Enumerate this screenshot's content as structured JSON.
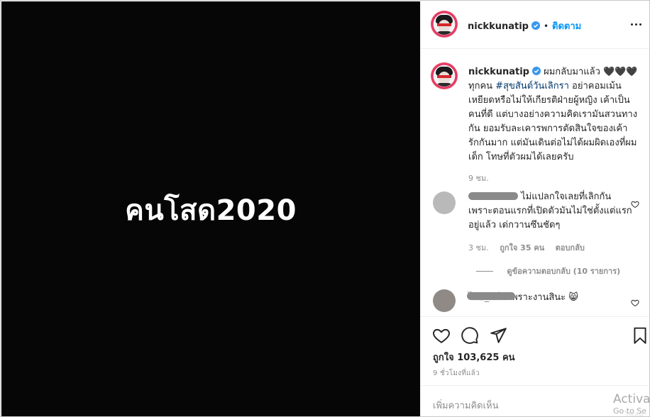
{
  "media": {
    "text": "คนโสด2020"
  },
  "header": {
    "username": "nickkunatip",
    "separator": "•",
    "follow_label": "ติดตาม"
  },
  "caption": {
    "username": "nickkunatip",
    "text_1": "ผมกลับมาแล้ว 🖤🖤🖤 ทุกคน ",
    "hashtag": "#สุขสันต์วันเลิกรา",
    "text_2": " อย่าคอมเม้นเหยียดหรือไม่ให้เกียรติฝ่ายผู้หญิง เค้าเป็นคนที่ดี แต่บางอย่างความคิดเรามันสวนทางกัน ยอมรับละเคารพการตัดสินใจของเค้า รักกันมาก แต่มันเดินต่อไม่ได้ผมผิดเองที่ผมเด็ก โทษที่ตัวผมได้เลยครับ",
    "time": "9 ชม."
  },
  "comments": [
    {
      "text": "ไม่แปลกใจเลยที่เลิกกัน เพราะตอนแรกที่เปิดตัวมันไม่ใช่ตั้งแต่แรกอยู่แล้ว เด่กวานซึนชัดๆ",
      "time": "3 ชม.",
      "likes": "ถูกใจ 35 คน",
      "reply_label": "ตอบกลับ",
      "view_replies": "ดูข้อความตอบกลับ (10 รายการ)"
    },
    {
      "username_fragment": "ไทย_ศรีส",
      "text": "เพราะงานสินะ 😸"
    }
  ],
  "actions": {
    "likes": "ถูกใจ 103,625 คน",
    "posted": "9 ชั่วโมงที่แล้ว"
  },
  "add_comment": {
    "placeholder": "เพิ่มความคิดเห็น"
  },
  "watermark": {
    "line1": "Activat",
    "line2": "Go to Se",
    "line3": "โพสต์"
  },
  "colors": {
    "accent": "#0095f6",
    "hashtag": "#00376b",
    "muted": "#8e8e8e",
    "media_bg": "#060606"
  }
}
